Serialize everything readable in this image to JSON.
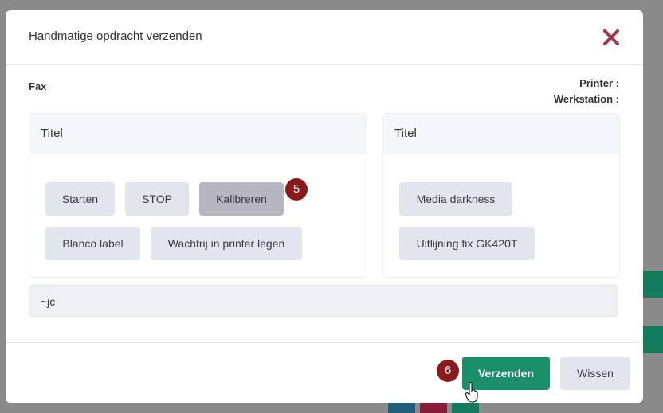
{
  "modal": {
    "title": "Handmatige opdracht verzenden",
    "printer_type": "Fax",
    "printer_label": "Printer :",
    "workstation_label": "Werkstation :"
  },
  "panels": [
    {
      "title": "Titel",
      "buttons": [
        "Starten",
        "STOP",
        "Kalibreren",
        "Blanco label",
        "Wachtrij in printer legen"
      ]
    },
    {
      "title": "Titel",
      "buttons": [
        "Media darkness",
        "Uitlijning fix GK420T"
      ]
    }
  ],
  "command_field": {
    "value": "~jc"
  },
  "footer": {
    "send_label": "Verzenden",
    "clear_label": "Wissen"
  },
  "badges": {
    "step_5": "5",
    "step_6": "6"
  },
  "colors": {
    "accent_green": "#1a8f6a",
    "close_icon": "#a3354f",
    "badge": "#8b1a1a",
    "active_button": "#b7b5c1"
  },
  "icons": {
    "close": "close-icon",
    "cursor": "hand-pointer-cursor-icon"
  }
}
